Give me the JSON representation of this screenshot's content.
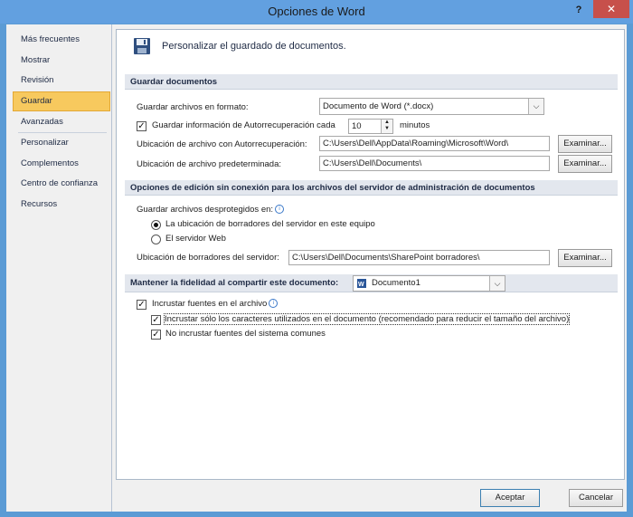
{
  "window": {
    "title": "Opciones de Word",
    "help": "?",
    "close": "✕"
  },
  "sidebar": {
    "items": [
      {
        "label": "Más frecuentes"
      },
      {
        "label": "Mostrar"
      },
      {
        "label": "Revisión"
      },
      {
        "label": "Guardar"
      },
      {
        "label": "Avanzadas"
      },
      {
        "label": "Personalizar"
      },
      {
        "label": "Complementos"
      },
      {
        "label": "Centro de confianza"
      },
      {
        "label": "Recursos"
      }
    ]
  },
  "header": {
    "title": "Personalizar el guardado de documentos."
  },
  "save_section": {
    "title": "Guardar documentos",
    "format_label": "Guardar archivos en formato:",
    "format_value": "Documento de Word (*.docx)",
    "autorecover_label": "Guardar información de Autorrecuperación cada",
    "autorecover_minutes": "10",
    "minutes_label": "minutos",
    "autorecover_location_label": "Ubicación de archivo con Autorrecuperación:",
    "autorecover_location_value": "C:\\Users\\Dell\\AppData\\Roaming\\Microsoft\\Word\\",
    "default_location_label": "Ubicación de archivo predeterminada:",
    "default_location_value": "C:\\Users\\Dell\\Documents\\",
    "browse": "Examinar..."
  },
  "offline_section": {
    "title": "Opciones de edición sin conexión para los archivos del servidor de administración de documentos",
    "save_checked_out_label": "Guardar archivos desprotegidos en:",
    "option_server_drafts": "La ubicación de borradores del servidor en este equipo",
    "option_web_server": "El servidor Web",
    "drafts_location_label": "Ubicación de borradores del servidor:",
    "drafts_location_value": "C:\\Users\\Dell\\Documents\\SharePoint borradores\\",
    "browse": "Examinar..."
  },
  "fidelity_section": {
    "title": "Mantener la fidelidad al compartir este documento:",
    "document_value": "Documento1",
    "embed_fonts": "Incrustar fuentes en el archivo",
    "embed_used_chars": "Incrustar sólo los caracteres utilizados en el documento (recomendado para reducir el tamaño del archivo)",
    "no_common_fonts": "No incrustar fuentes del sistema comunes"
  },
  "footer": {
    "ok": "Aceptar",
    "cancel": "Cancelar"
  },
  "colors": {
    "titlebar": "#62a0e0",
    "close": "#c7504b",
    "active_nav": "#f7c95e",
    "section_bg": "#e3e7ee"
  }
}
